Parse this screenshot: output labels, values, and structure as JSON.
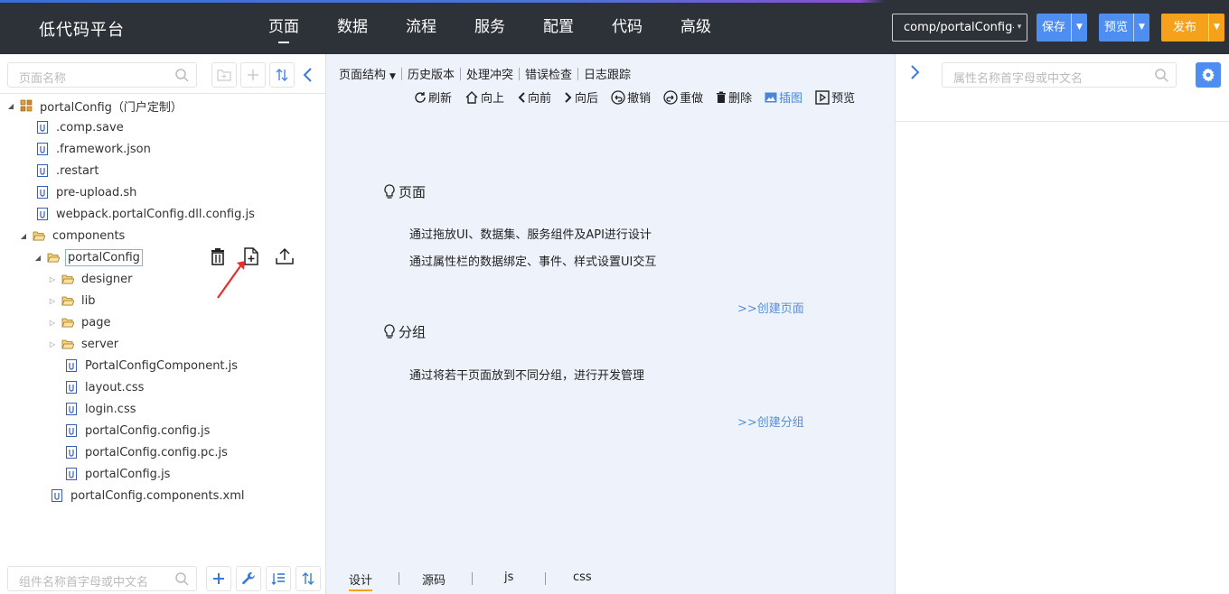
{
  "app": {
    "title": "低代码平台"
  },
  "nav": [
    {
      "label": "页面",
      "active": true
    },
    {
      "label": "数据",
      "active": false
    },
    {
      "label": "流程",
      "active": false
    },
    {
      "label": "服务",
      "active": false
    },
    {
      "label": "配置",
      "active": false
    },
    {
      "label": "代码",
      "active": false
    },
    {
      "label": "高级",
      "active": false
    }
  ],
  "header": {
    "component_select": "comp/portalConfig-",
    "save_label": "保存",
    "preview_label": "预览",
    "publish_label": "发布",
    "accent_color": "#4d8ef0",
    "publish_color": "#f5a11b"
  },
  "left": {
    "search_placeholder": "页面名称",
    "component_search_placeholder": "组件名称首字母或中文名",
    "tree": [
      {
        "label": "portalConfig（门户定制）",
        "type": "root",
        "toggle": "open"
      },
      {
        "label": ".comp.save",
        "type": "file"
      },
      {
        "label": ".framework.json",
        "type": "file"
      },
      {
        "label": ".restart",
        "type": "file"
      },
      {
        "label": "pre-upload.sh",
        "type": "file"
      },
      {
        "label": "webpack.portalConfig.dll.config.js",
        "type": "file"
      },
      {
        "label": "components",
        "type": "folder",
        "toggle": "open"
      },
      {
        "label": "portalConfig",
        "type": "folder",
        "toggle": "open",
        "selected": true
      },
      {
        "label": "designer",
        "type": "folder",
        "toggle": "closed"
      },
      {
        "label": "lib",
        "type": "folder",
        "toggle": "closed"
      },
      {
        "label": "page",
        "type": "folder",
        "toggle": "closed"
      },
      {
        "label": "server",
        "type": "folder",
        "toggle": "closed"
      },
      {
        "label": "PortalConfigComponent.js",
        "type": "file"
      },
      {
        "label": "layout.css",
        "type": "file"
      },
      {
        "label": "login.css",
        "type": "file"
      },
      {
        "label": "portalConfig.config.js",
        "type": "file"
      },
      {
        "label": "portalConfig.config.pc.js",
        "type": "file"
      },
      {
        "label": "portalConfig.js",
        "type": "file"
      },
      {
        "label": "portalConfig.components.xml",
        "type": "file"
      }
    ]
  },
  "center": {
    "sub_tabs": [
      "页面结构",
      "历史版本",
      "处理冲突",
      "错误检查",
      "日志跟踪"
    ],
    "toolbar": [
      "刷新",
      "向上",
      "向前",
      "向后",
      "撤销",
      "重做",
      "删除",
      "插图",
      "预览"
    ],
    "sections": [
      {
        "title": "页面",
        "lines": [
          "通过拖放UI、数据集、服务组件及API进行设计",
          "通过属性栏的数据绑定、事件、样式设置UI交互"
        ],
        "link": ">>创建页面"
      },
      {
        "title": "分组",
        "lines": [
          "通过将若干页面放到不同分组，进行开发管理"
        ],
        "link": ">>创建分组"
      }
    ],
    "bottom_tabs": [
      "设计",
      "源码",
      "js",
      "css"
    ]
  },
  "right": {
    "search_placeholder": "属性名称首字母或中文名"
  }
}
